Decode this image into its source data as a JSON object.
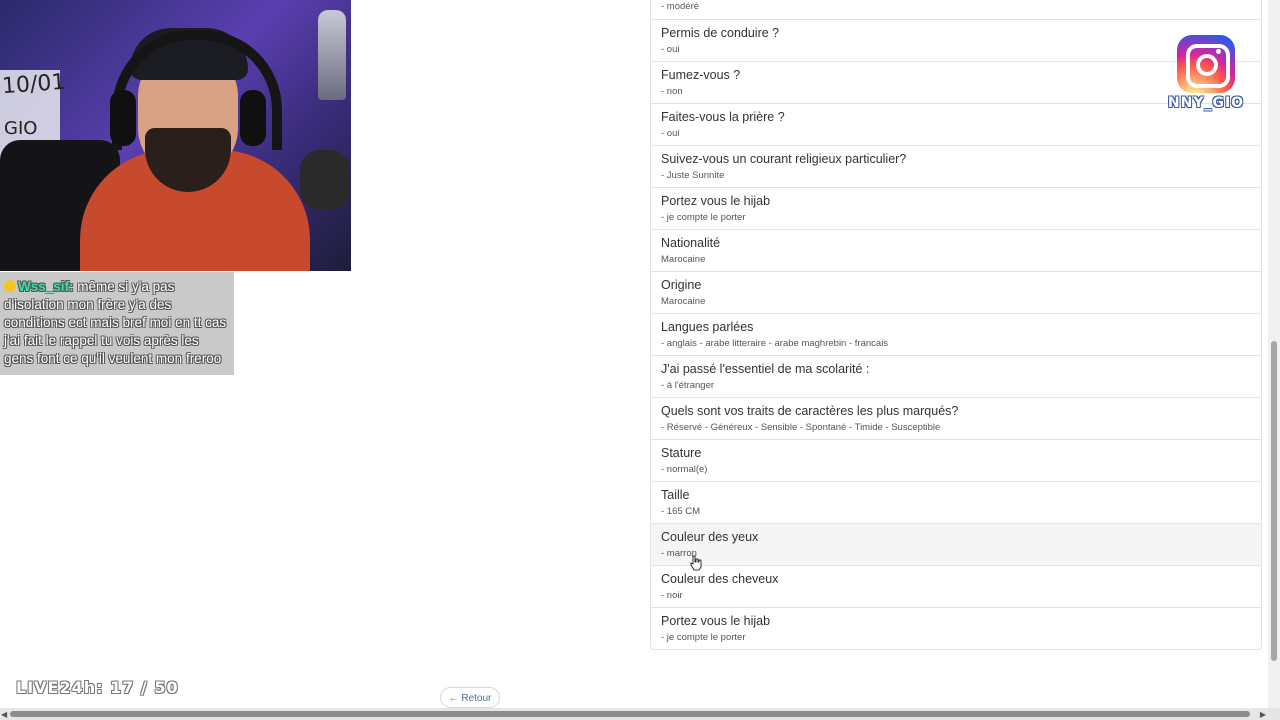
{
  "chat": {
    "username": "Wss_sif",
    "message": "même si y'a pas d'isolation mon frère y'a des conditions ect mais bref moi en tt cas j'ai fait le rappel tu vois après les gens font ce qu'il veulent mon freroo"
  },
  "webcam": {
    "shelf_text": "10/01",
    "shelf_text2": "GIO"
  },
  "profile_items": [
    {
      "question": "",
      "answer": "- modéré"
    },
    {
      "question": "Permis de conduire ?",
      "answer": "- oui"
    },
    {
      "question": "Fumez-vous ?",
      "answer": "- non"
    },
    {
      "question": "Faites-vous la prière ?",
      "answer": "- oui"
    },
    {
      "question": "Suivez-vous un courant religieux particulier?",
      "answer": "- Juste Sunnite"
    },
    {
      "question": "Portez vous le hijab",
      "answer": "- je compte le porter"
    },
    {
      "question": "Nationalité",
      "answer": "Marocaine"
    },
    {
      "question": "Origine",
      "answer": "Marocaine"
    },
    {
      "question": "Langues parlées",
      "answer": "- anglais - arabe litteraire - arabe maghrebin - francais"
    },
    {
      "question": "J'ai passé l'essentiel de ma scolarité :",
      "answer": "- à l'étranger"
    },
    {
      "question": "Quels sont vos traits de caractères les plus marqués?",
      "answer": "- Réservé - Généreux - Sensible - Spontané - Timide - Susceptible"
    },
    {
      "question": "Stature",
      "answer": "- normal(e)"
    },
    {
      "question": "Taille",
      "answer": "- 165 CM"
    },
    {
      "question": "Couleur des yeux",
      "answer": "- marron"
    },
    {
      "question": "Couleur des cheveux",
      "answer": "- noir"
    },
    {
      "question": "Portez vous le hijab",
      "answer": "- je compte le porter"
    }
  ],
  "instagram": {
    "handle": "NNY_GIO"
  },
  "live_counter": "LIVE24h: 17 / 50",
  "retour_label": "← Retour",
  "colors": {
    "chat_username": "#38e0a8",
    "link": "#4a6fa5"
  }
}
